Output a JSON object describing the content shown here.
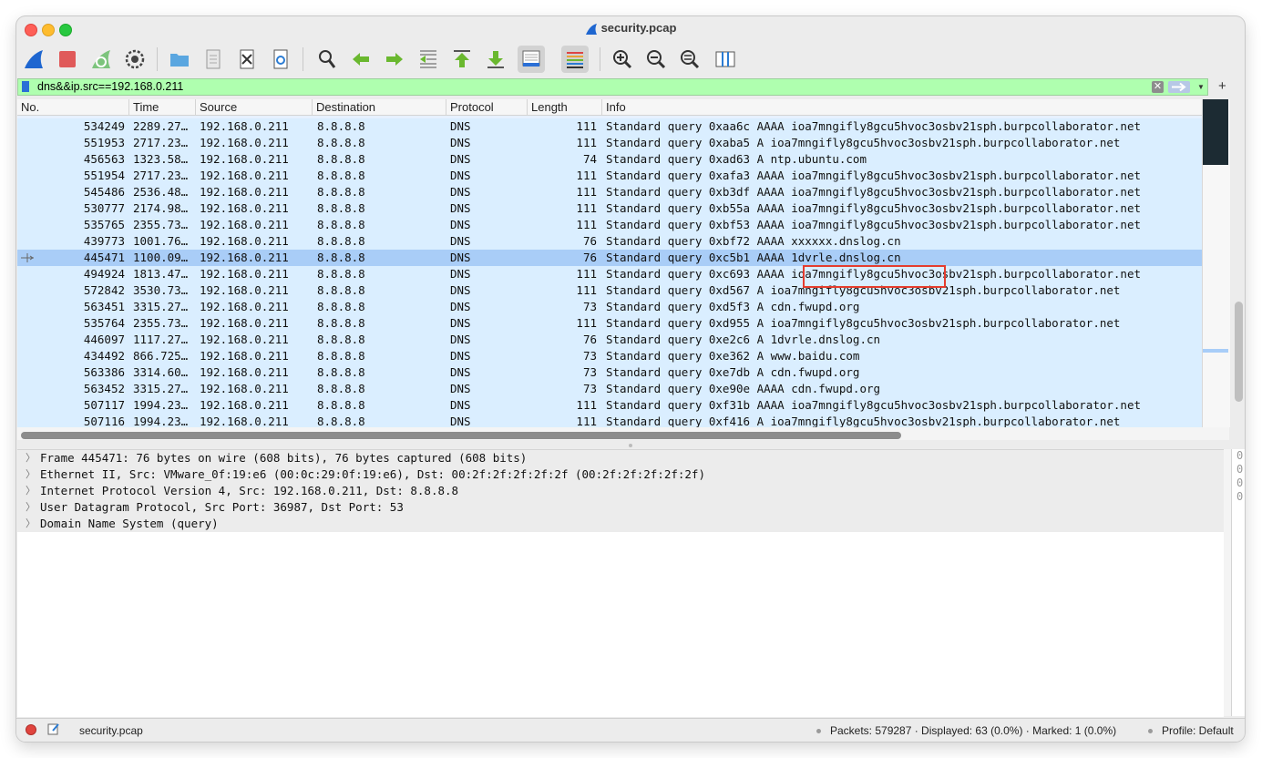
{
  "window": {
    "title": "security.pcap"
  },
  "filter": {
    "value": "dns&&ip.src==192.168.0.211",
    "clear_glyph": "✕",
    "add_glyph": "+"
  },
  "columns": [
    "No.",
    "Time",
    "Source",
    "Destination",
    "Protocol",
    "Length",
    "Info"
  ],
  "packets": [
    {
      "no": "534249",
      "time": "2289.27…",
      "src": "192.168.0.211",
      "dst": "8.8.8.8",
      "proto": "DNS",
      "len": "111",
      "info": "Standard query 0xaa6c AAAA ioa7mngifly8gcu5hvoc3osbv21sph.burpcollaborator.net"
    },
    {
      "no": "551953",
      "time": "2717.23…",
      "src": "192.168.0.211",
      "dst": "8.8.8.8",
      "proto": "DNS",
      "len": "111",
      "info": "Standard query 0xaba5 A ioa7mngifly8gcu5hvoc3osbv21sph.burpcollaborator.net"
    },
    {
      "no": "456563",
      "time": "1323.58…",
      "src": "192.168.0.211",
      "dst": "8.8.8.8",
      "proto": "DNS",
      "len": "74",
      "info": "Standard query 0xad63 A ntp.ubuntu.com"
    },
    {
      "no": "551954",
      "time": "2717.23…",
      "src": "192.168.0.211",
      "dst": "8.8.8.8",
      "proto": "DNS",
      "len": "111",
      "info": "Standard query 0xafa3 AAAA ioa7mngifly8gcu5hvoc3osbv21sph.burpcollaborator.net"
    },
    {
      "no": "545486",
      "time": "2536.48…",
      "src": "192.168.0.211",
      "dst": "8.8.8.8",
      "proto": "DNS",
      "len": "111",
      "info": "Standard query 0xb3df AAAA ioa7mngifly8gcu5hvoc3osbv21sph.burpcollaborator.net"
    },
    {
      "no": "530777",
      "time": "2174.98…",
      "src": "192.168.0.211",
      "dst": "8.8.8.8",
      "proto": "DNS",
      "len": "111",
      "info": "Standard query 0xb55a AAAA ioa7mngifly8gcu5hvoc3osbv21sph.burpcollaborator.net"
    },
    {
      "no": "535765",
      "time": "2355.73…",
      "src": "192.168.0.211",
      "dst": "8.8.8.8",
      "proto": "DNS",
      "len": "111",
      "info": "Standard query 0xbf53 AAAA ioa7mngifly8gcu5hvoc3osbv21sph.burpcollaborator.net"
    },
    {
      "no": "439773",
      "time": "1001.76…",
      "src": "192.168.0.211",
      "dst": "8.8.8.8",
      "proto": "DNS",
      "len": "76",
      "info": "Standard query 0xbf72 AAAA xxxxxx.dnslog.cn"
    },
    {
      "no": "445471",
      "time": "1100.09…",
      "src": "192.168.0.211",
      "dst": "8.8.8.8",
      "proto": "DNS",
      "len": "76",
      "info": "Standard query 0xc5b1 AAAA 1dvrle.dnslog.cn",
      "selected": true
    },
    {
      "no": "494924",
      "time": "1813.47…",
      "src": "192.168.0.211",
      "dst": "8.8.8.8",
      "proto": "DNS",
      "len": "111",
      "info": "Standard query 0xc693 AAAA ioa7mngifly8gcu5hvoc3osbv21sph.burpcollaborator.net"
    },
    {
      "no": "572842",
      "time": "3530.73…",
      "src": "192.168.0.211",
      "dst": "8.8.8.8",
      "proto": "DNS",
      "len": "111",
      "info": "Standard query 0xd567 A ioa7mngifly8gcu5hvoc3osbv21sph.burpcollaborator.net"
    },
    {
      "no": "563451",
      "time": "3315.27…",
      "src": "192.168.0.211",
      "dst": "8.8.8.8",
      "proto": "DNS",
      "len": "73",
      "info": "Standard query 0xd5f3 A cdn.fwupd.org"
    },
    {
      "no": "535764",
      "time": "2355.73…",
      "src": "192.168.0.211",
      "dst": "8.8.8.8",
      "proto": "DNS",
      "len": "111",
      "info": "Standard query 0xd955 A ioa7mngifly8gcu5hvoc3osbv21sph.burpcollaborator.net"
    },
    {
      "no": "446097",
      "time": "1117.27…",
      "src": "192.168.0.211",
      "dst": "8.8.8.8",
      "proto": "DNS",
      "len": "76",
      "info": "Standard query 0xe2c6 A 1dvrle.dnslog.cn"
    },
    {
      "no": "434492",
      "time": "866.725…",
      "src": "192.168.0.211",
      "dst": "8.8.8.8",
      "proto": "DNS",
      "len": "73",
      "info": "Standard query 0xe362 A www.baidu.com"
    },
    {
      "no": "563386",
      "time": "3314.60…",
      "src": "192.168.0.211",
      "dst": "8.8.8.8",
      "proto": "DNS",
      "len": "73",
      "info": "Standard query 0xe7db A cdn.fwupd.org"
    },
    {
      "no": "563452",
      "time": "3315.27…",
      "src": "192.168.0.211",
      "dst": "8.8.8.8",
      "proto": "DNS",
      "len": "73",
      "info": "Standard query 0xe90e AAAA cdn.fwupd.org"
    },
    {
      "no": "507117",
      "time": "1994.23…",
      "src": "192.168.0.211",
      "dst": "8.8.8.8",
      "proto": "DNS",
      "len": "111",
      "info": "Standard query 0xf31b AAAA ioa7mngifly8gcu5hvoc3osbv21sph.burpcollaborator.net"
    },
    {
      "no": "507116",
      "time": "1994.23…",
      "src": "192.168.0.211",
      "dst": "8.8.8.8",
      "proto": "DNS",
      "len": "111",
      "info": "Standard query 0xf416 A ioa7mngifly8gcu5hvoc3osbv21sph.burpcollaborator.net"
    }
  ],
  "details": [
    "Frame 445471: 76 bytes on wire (608 bits), 76 bytes captured (608 bits)",
    "Ethernet II, Src: VMware_0f:19:e6 (00:0c:29:0f:19:e6), Dst: 00:2f:2f:2f:2f:2f (00:2f:2f:2f:2f:2f)",
    "Internet Protocol Version 4, Src: 192.168.0.211, Dst: 8.8.8.8",
    "User Datagram Protocol, Src Port: 36987, Dst Port: 53",
    "Domain Name System (query)"
  ],
  "bytes_pane": [
    "0",
    "0",
    "0",
    "0"
  ],
  "status": {
    "file": "security.pcap",
    "stats": "Packets: 579287 · Displayed: 63 (0.0%) · Marked: 1 (0.0%)",
    "profile": "Profile: Default"
  },
  "colors": {
    "filter_valid": "#afffaf",
    "row_bg": "#daeeff",
    "row_selected": "#a9cdf7",
    "annotation_box": "#e53c2e"
  },
  "toolbar_icons": [
    "start-capture-icon",
    "stop-capture-icon",
    "restart-capture-icon",
    "capture-options-icon",
    "open-file-icon",
    "save-file-icon",
    "close-file-icon",
    "reload-file-icon",
    "find-packet-icon",
    "go-back-icon",
    "go-forward-icon",
    "go-to-packet-icon",
    "go-first-icon",
    "go-last-icon",
    "autoscroll-icon",
    "colorize-icon",
    "zoom-in-icon",
    "zoom-out-icon",
    "zoom-reset-icon",
    "resize-columns-icon"
  ]
}
